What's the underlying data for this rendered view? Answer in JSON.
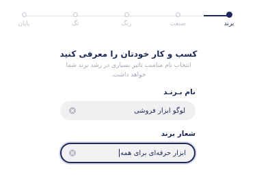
{
  "stepper": {
    "steps": [
      {
        "label": "برند",
        "state": "active"
      },
      {
        "label": "صنعت",
        "state": "pending"
      },
      {
        "label": "رنگ",
        "state": "pending"
      },
      {
        "label": "تگ",
        "state": "pending"
      },
      {
        "label": "پایان",
        "state": "pending"
      }
    ]
  },
  "intro": {
    "title": "کسب و کار خودتان را معرفی کنید",
    "subtitle": "انتخاب نام مناسب تاثیر بسیاری در رشد برند شما خواهد داشت."
  },
  "form": {
    "brand_name": {
      "label": "نام بـرنـد",
      "value": "لوگو ابزار فروشی",
      "clear_icon": "clear-icon"
    },
    "slogan": {
      "label": "شعار برند",
      "value": "ابزار حرفه‌ای برای همه",
      "clear_icon": "clear-icon",
      "focused": true
    }
  },
  "colors": {
    "primary": "#1d2757",
    "muted": "#c0c3ce",
    "field_bg": "#f0f0f2",
    "clear_icon_bg": "#b8bac1"
  }
}
